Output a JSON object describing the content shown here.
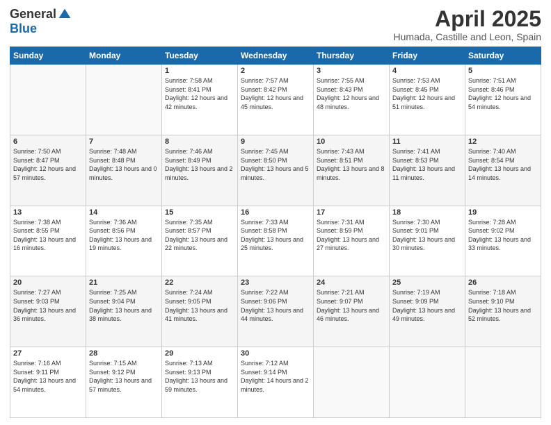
{
  "header": {
    "logo_general": "General",
    "logo_blue": "Blue",
    "month_title": "April 2025",
    "location": "Humada, Castille and Leon, Spain"
  },
  "weekdays": [
    "Sunday",
    "Monday",
    "Tuesday",
    "Wednesday",
    "Thursday",
    "Friday",
    "Saturday"
  ],
  "weeks": [
    [
      {
        "day": "",
        "sunrise": "",
        "sunset": "",
        "daylight": ""
      },
      {
        "day": "",
        "sunrise": "",
        "sunset": "",
        "daylight": ""
      },
      {
        "day": "1",
        "sunrise": "Sunrise: 7:58 AM",
        "sunset": "Sunset: 8:41 PM",
        "daylight": "Daylight: 12 hours and 42 minutes."
      },
      {
        "day": "2",
        "sunrise": "Sunrise: 7:57 AM",
        "sunset": "Sunset: 8:42 PM",
        "daylight": "Daylight: 12 hours and 45 minutes."
      },
      {
        "day": "3",
        "sunrise": "Sunrise: 7:55 AM",
        "sunset": "Sunset: 8:43 PM",
        "daylight": "Daylight: 12 hours and 48 minutes."
      },
      {
        "day": "4",
        "sunrise": "Sunrise: 7:53 AM",
        "sunset": "Sunset: 8:45 PM",
        "daylight": "Daylight: 12 hours and 51 minutes."
      },
      {
        "day": "5",
        "sunrise": "Sunrise: 7:51 AM",
        "sunset": "Sunset: 8:46 PM",
        "daylight": "Daylight: 12 hours and 54 minutes."
      }
    ],
    [
      {
        "day": "6",
        "sunrise": "Sunrise: 7:50 AM",
        "sunset": "Sunset: 8:47 PM",
        "daylight": "Daylight: 12 hours and 57 minutes."
      },
      {
        "day": "7",
        "sunrise": "Sunrise: 7:48 AM",
        "sunset": "Sunset: 8:48 PM",
        "daylight": "Daylight: 13 hours and 0 minutes."
      },
      {
        "day": "8",
        "sunrise": "Sunrise: 7:46 AM",
        "sunset": "Sunset: 8:49 PM",
        "daylight": "Daylight: 13 hours and 2 minutes."
      },
      {
        "day": "9",
        "sunrise": "Sunrise: 7:45 AM",
        "sunset": "Sunset: 8:50 PM",
        "daylight": "Daylight: 13 hours and 5 minutes."
      },
      {
        "day": "10",
        "sunrise": "Sunrise: 7:43 AM",
        "sunset": "Sunset: 8:51 PM",
        "daylight": "Daylight: 13 hours and 8 minutes."
      },
      {
        "day": "11",
        "sunrise": "Sunrise: 7:41 AM",
        "sunset": "Sunset: 8:53 PM",
        "daylight": "Daylight: 13 hours and 11 minutes."
      },
      {
        "day": "12",
        "sunrise": "Sunrise: 7:40 AM",
        "sunset": "Sunset: 8:54 PM",
        "daylight": "Daylight: 13 hours and 14 minutes."
      }
    ],
    [
      {
        "day": "13",
        "sunrise": "Sunrise: 7:38 AM",
        "sunset": "Sunset: 8:55 PM",
        "daylight": "Daylight: 13 hours and 16 minutes."
      },
      {
        "day": "14",
        "sunrise": "Sunrise: 7:36 AM",
        "sunset": "Sunset: 8:56 PM",
        "daylight": "Daylight: 13 hours and 19 minutes."
      },
      {
        "day": "15",
        "sunrise": "Sunrise: 7:35 AM",
        "sunset": "Sunset: 8:57 PM",
        "daylight": "Daylight: 13 hours and 22 minutes."
      },
      {
        "day": "16",
        "sunrise": "Sunrise: 7:33 AM",
        "sunset": "Sunset: 8:58 PM",
        "daylight": "Daylight: 13 hours and 25 minutes."
      },
      {
        "day": "17",
        "sunrise": "Sunrise: 7:31 AM",
        "sunset": "Sunset: 8:59 PM",
        "daylight": "Daylight: 13 hours and 27 minutes."
      },
      {
        "day": "18",
        "sunrise": "Sunrise: 7:30 AM",
        "sunset": "Sunset: 9:01 PM",
        "daylight": "Daylight: 13 hours and 30 minutes."
      },
      {
        "day": "19",
        "sunrise": "Sunrise: 7:28 AM",
        "sunset": "Sunset: 9:02 PM",
        "daylight": "Daylight: 13 hours and 33 minutes."
      }
    ],
    [
      {
        "day": "20",
        "sunrise": "Sunrise: 7:27 AM",
        "sunset": "Sunset: 9:03 PM",
        "daylight": "Daylight: 13 hours and 36 minutes."
      },
      {
        "day": "21",
        "sunrise": "Sunrise: 7:25 AM",
        "sunset": "Sunset: 9:04 PM",
        "daylight": "Daylight: 13 hours and 38 minutes."
      },
      {
        "day": "22",
        "sunrise": "Sunrise: 7:24 AM",
        "sunset": "Sunset: 9:05 PM",
        "daylight": "Daylight: 13 hours and 41 minutes."
      },
      {
        "day": "23",
        "sunrise": "Sunrise: 7:22 AM",
        "sunset": "Sunset: 9:06 PM",
        "daylight": "Daylight: 13 hours and 44 minutes."
      },
      {
        "day": "24",
        "sunrise": "Sunrise: 7:21 AM",
        "sunset": "Sunset: 9:07 PM",
        "daylight": "Daylight: 13 hours and 46 minutes."
      },
      {
        "day": "25",
        "sunrise": "Sunrise: 7:19 AM",
        "sunset": "Sunset: 9:09 PM",
        "daylight": "Daylight: 13 hours and 49 minutes."
      },
      {
        "day": "26",
        "sunrise": "Sunrise: 7:18 AM",
        "sunset": "Sunset: 9:10 PM",
        "daylight": "Daylight: 13 hours and 52 minutes."
      }
    ],
    [
      {
        "day": "27",
        "sunrise": "Sunrise: 7:16 AM",
        "sunset": "Sunset: 9:11 PM",
        "daylight": "Daylight: 13 hours and 54 minutes."
      },
      {
        "day": "28",
        "sunrise": "Sunrise: 7:15 AM",
        "sunset": "Sunset: 9:12 PM",
        "daylight": "Daylight: 13 hours and 57 minutes."
      },
      {
        "day": "29",
        "sunrise": "Sunrise: 7:13 AM",
        "sunset": "Sunset: 9:13 PM",
        "daylight": "Daylight: 13 hours and 59 minutes."
      },
      {
        "day": "30",
        "sunrise": "Sunrise: 7:12 AM",
        "sunset": "Sunset: 9:14 PM",
        "daylight": "Daylight: 14 hours and 2 minutes."
      },
      {
        "day": "",
        "sunrise": "",
        "sunset": "",
        "daylight": ""
      },
      {
        "day": "",
        "sunrise": "",
        "sunset": "",
        "daylight": ""
      },
      {
        "day": "",
        "sunrise": "",
        "sunset": "",
        "daylight": ""
      }
    ]
  ]
}
